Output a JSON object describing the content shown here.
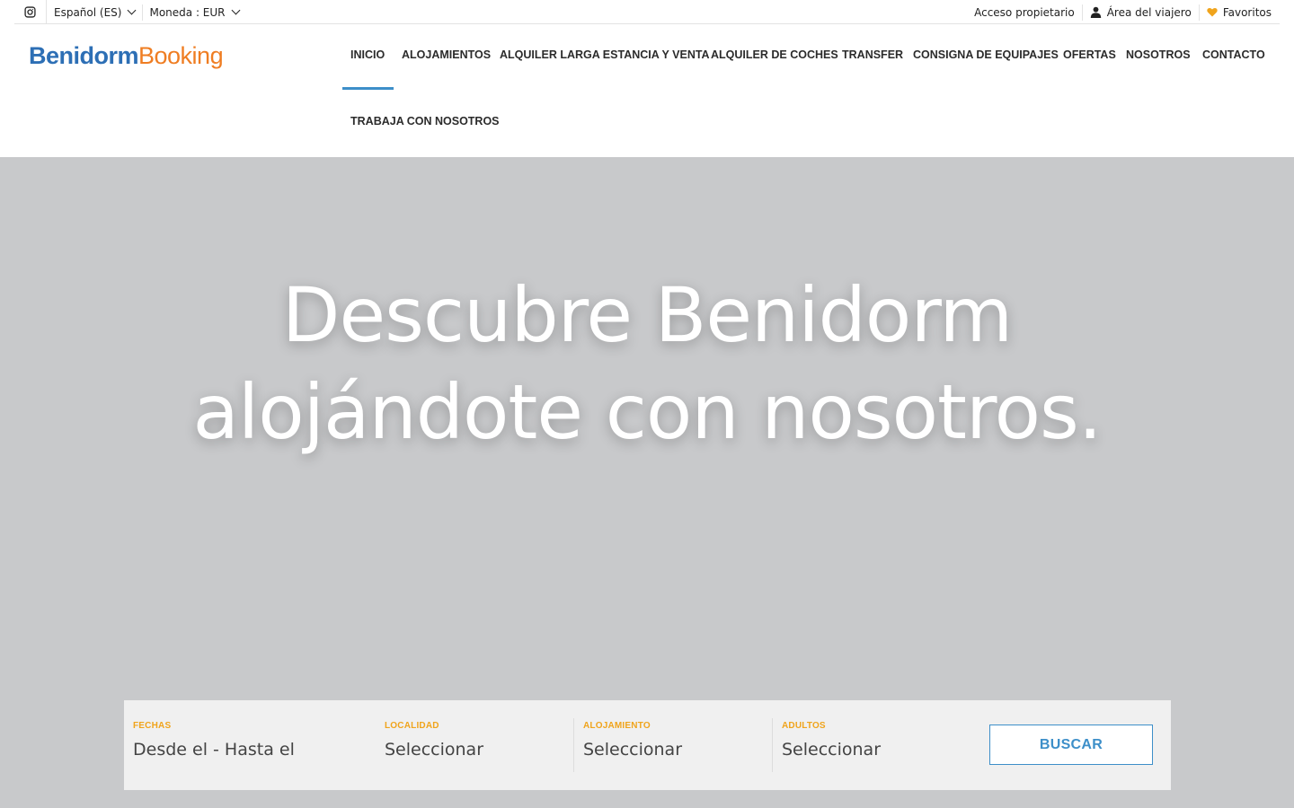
{
  "topbar": {
    "instagram_icon": "instagram-icon",
    "language": "Español (ES)",
    "currency": "Moneda : EUR",
    "owner_access": "Acceso propietario",
    "traveler_area": "Área del viajero",
    "favorites": "Favoritos"
  },
  "logo": {
    "part1": "Benidorm",
    "part2": "Booking",
    "color_part1": "#2d6fb5",
    "color_part2": "#ef7d22"
  },
  "nav": {
    "items": [
      "INICIO",
      "ALOJAMIENTOS",
      "ALQUILER LARGA ESTANCIA Y VENTA",
      "ALQUILER DE COCHES",
      "TRANSFER",
      "CONSIGNA DE EQUIPAJES",
      "OFERTAS",
      "NOSOTROS",
      "CONTACTO",
      "TRABAJA CON NOSOTROS"
    ],
    "active": "INICIO",
    "accent_color": "#3d8fc9"
  },
  "hero": {
    "line1": "Descubre Benidorm",
    "line2": "alojándote con nosotros."
  },
  "search": {
    "dates_label": "FECHAS",
    "dates_value": "Desde el - Hasta el",
    "location_label": "LOCALIDAD",
    "location_value": "Seleccionar",
    "accommodation_label": "ALOJAMIENTO",
    "accommodation_value": "Seleccionar",
    "adults_label": "ADULTOS",
    "adults_value": "Seleccionar",
    "button": "BUSCAR",
    "label_color": "#f0a41c"
  }
}
